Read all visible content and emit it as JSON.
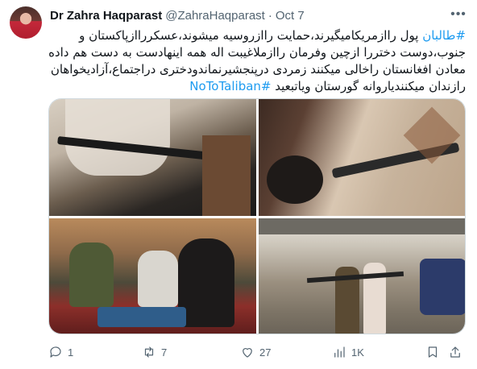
{
  "author": {
    "display_name": "Dr Zahra Haqparast",
    "handle": "@ZahraHaqparast",
    "separator": "·",
    "date": "Oct 7"
  },
  "tweet": {
    "hashtag_top": "#طالبان",
    "line1_rest": " پول راازمریکامیگیرند،حمایت راازروسیه میشوند،عسکرراازپاکستان و",
    "line2": "جنوب،دوست دختررا ازچین وفرمان راازملاغیبت اله همه اینهادست به دست هم داده",
    "line3": "معادن افغانستان راخالی میکنند زمردی درپنجشیرنماندودختری دراجتماع،آزادیخواهان",
    "line4_rest": "رازندان میکنندیاروانه گورستان ویاتبعید ",
    "hashtag_end": "#NoToTaliban"
  },
  "actions": {
    "replies": "1",
    "retweets": "7",
    "likes": "27",
    "views": "1K"
  },
  "colors": {
    "accent": "#1d9bf0",
    "secondary_text": "#536471",
    "border": "#cfd9de"
  }
}
